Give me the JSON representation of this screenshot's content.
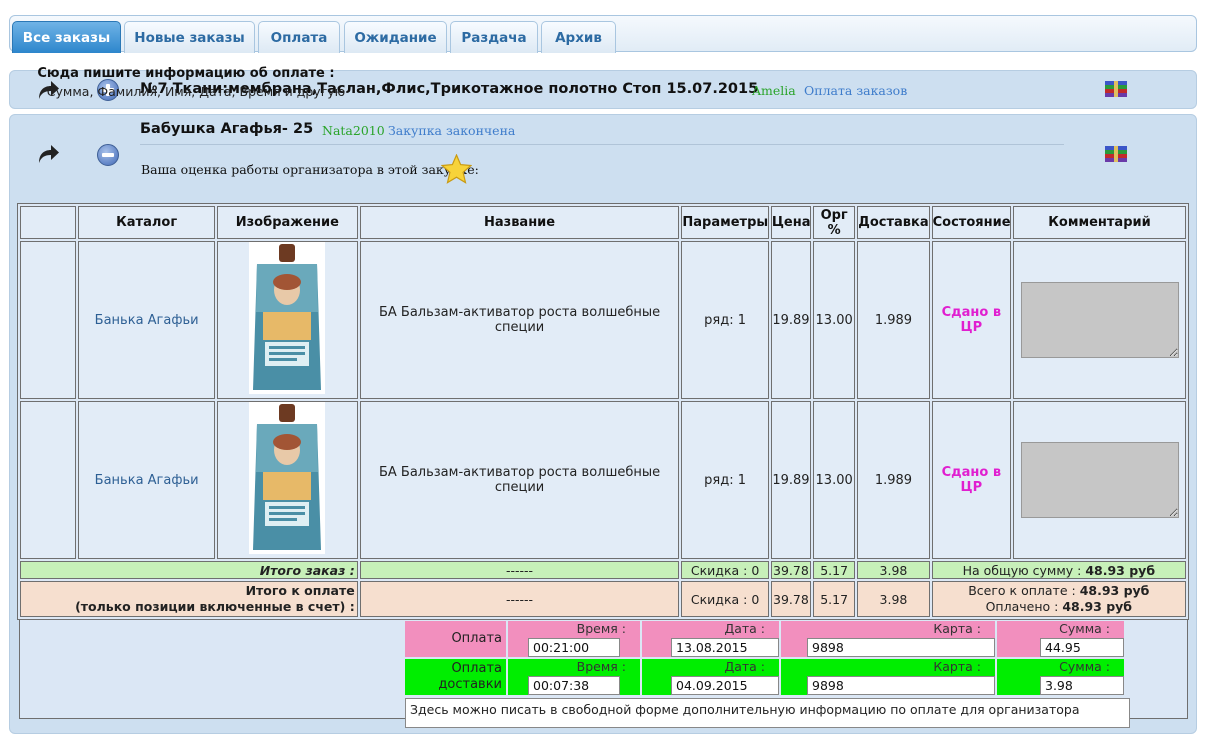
{
  "tabs": [
    {
      "label": "Все заказы",
      "active": true
    },
    {
      "label": "Новые заказы",
      "active": false
    },
    {
      "label": "Оплата",
      "active": false
    },
    {
      "label": "Ожидание",
      "active": false
    },
    {
      "label": "Раздача",
      "active": false
    },
    {
      "label": "Архив",
      "active": false
    }
  ],
  "purchase1": {
    "title": "№7 Ткани:мембрана,Таслан,Флис,Трикотажное полотно Стоп 15.07.2015",
    "organizer": "Amelia",
    "status": "Оплата заказов"
  },
  "purchase2": {
    "title": "Бабушка Агафья- 25",
    "organizer": "Nata2010",
    "status": "Закупка закончена",
    "rating_text": "Ваша оценка работы организатора в этой закупке:"
  },
  "table": {
    "headers": [
      "",
      "Каталог",
      "Изображение",
      "Название",
      "Параметры",
      "Цена",
      "Орг %",
      "Доставка",
      "Состояние",
      "Комментарий"
    ],
    "rows": [
      {
        "catalog": "Банька Агафьи",
        "name": "БА Бальзам-активатор роста волшебные специи",
        "params": "ряд: 1",
        "price": "19.89",
        "org": "13.00",
        "delivery": "1.989",
        "state": "Сдано в ЦР"
      },
      {
        "catalog": "Банька Агафьи",
        "name": "БА Бальзам-активатор роста волшебные специи",
        "params": "ряд: 1",
        "price": "19.89",
        "org": "13.00",
        "delivery": "1.989",
        "state": "Сдано в ЦР"
      }
    ],
    "total": {
      "label": "Итого заказ :",
      "dash": "------",
      "discount": "Скидка : 0",
      "price": "39.78",
      "org": "5.17",
      "delivery": "3.98",
      "sum_label": "На общую сумму :",
      "sum_value": "48.93 руб"
    },
    "topay": {
      "label_line1": "Итого к оплате",
      "label_line2": "(только позиции включенные в счет) :",
      "dash": "------",
      "discount": "Скидка : 0",
      "price": "39.78",
      "org": "5.17",
      "delivery": "3.98",
      "total_label": "Всего к оплате :",
      "total_value": "48.93 руб",
      "paid_label": "Оплачено :",
      "paid_value": "48.93 руб"
    }
  },
  "payment": {
    "help_title": "Сюда пишите информацию об оплате :",
    "help_sub": "Сумма, Фамилия, Имя, Дата, Время и другую",
    "order": {
      "label": "Оплата заказа",
      "time_label": "Время :",
      "time": "00:21:00",
      "date_label": "Дата :",
      "date": "13.08.2015",
      "card_label": "Карта :",
      "card": "9898",
      "sum_label": "Сумма :",
      "sum": "44.95",
      "color": "#f28fbe"
    },
    "delivery": {
      "label_line1": "Оплата",
      "label_line2": "доставки",
      "time_label": "Время :",
      "time": "00:07:38",
      "date_label": "Дата :",
      "date": "04.09.2015",
      "card_label": "Карта :",
      "card": "9898",
      "sum_label": "Сумма :",
      "sum": "3.98",
      "color": "#00ee00"
    },
    "free_text": "Здесь можно писать в свободной форме дополнительную информацию по оплате для организатора"
  }
}
